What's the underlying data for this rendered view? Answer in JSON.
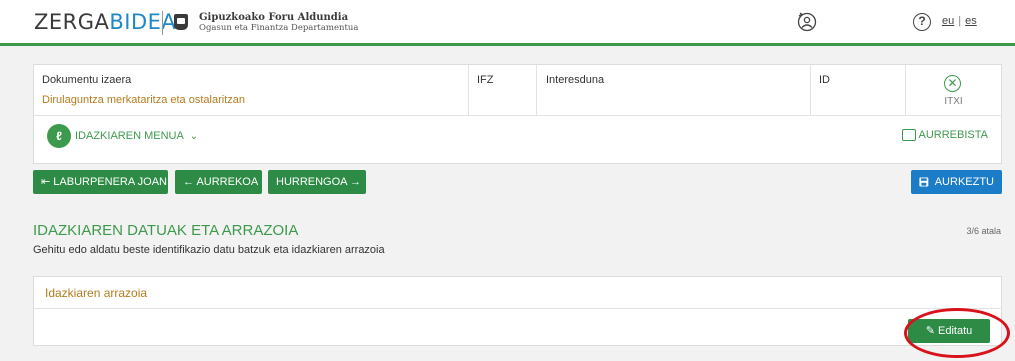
{
  "header": {
    "logo_part1": "ZERGA",
    "logo_part2": "BIDEA",
    "org_line1": "Gipuzkoako Foru Aldundia",
    "org_line2": "Ogasun eta Finantza Departamentua",
    "lang_eu": "eu",
    "lang_es": "es",
    "help_symbol": "?",
    "icons": [
      "user-settings-icon",
      "help-icon"
    ]
  },
  "info": {
    "doc_label": "Dokumentu izaera",
    "doc_value": "Dirulaguntza merkataritza eta ostalaritzan",
    "ifz_label": "IFZ",
    "interested_label": "Interesduna",
    "id_label": "ID",
    "close_label": "ITXI",
    "close_symbol": "✕",
    "menu_label": "IDAZKIAREN MENUA",
    "menu_caret": "⌄",
    "print_label": "AURREBISTA"
  },
  "nav": {
    "summary": "⇤ LABURPENERA JOAN",
    "prev": "← AURREKOA",
    "next": "HURRENGOA →",
    "submit": "AURKEZTU"
  },
  "section": {
    "title": "IDAZKIAREN DATUAK ETA ARRAZOIA",
    "subtitle": "Gehitu edo aldatu beste identifikazio datu batzuk eta idazkiaren arrazoia",
    "step": "3/6 atala"
  },
  "reason": {
    "title": "Idazkiaren arrazoia",
    "edit_label": "✎ Editatu"
  },
  "colors": {
    "green": "#3d9a4d",
    "button_green": "#2e8b46",
    "blue": "#1b7cc8",
    "gold": "#b07d1e",
    "highlight_red": "#d9121b"
  }
}
